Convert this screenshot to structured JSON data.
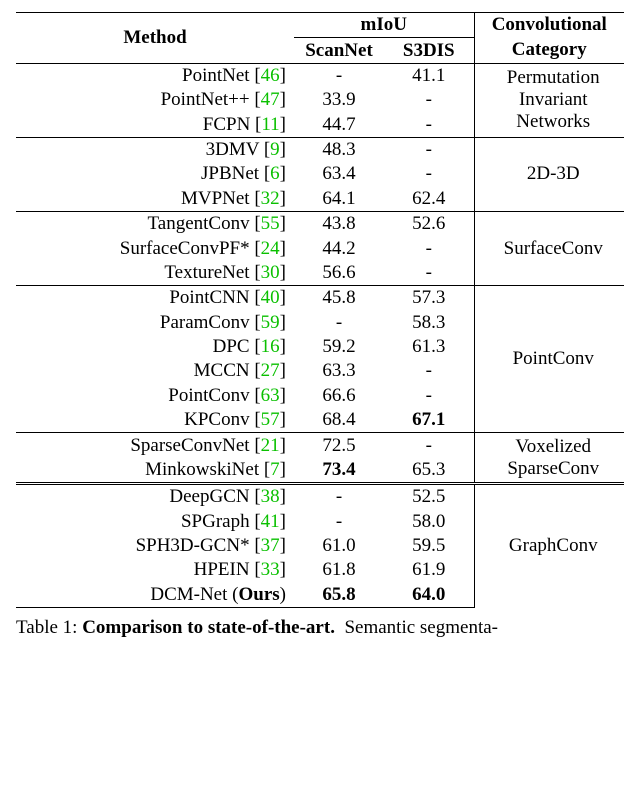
{
  "headers": {
    "method": "Method",
    "miou": "mIoU",
    "scannet": "ScanNet",
    "s3dis": "S3DIS",
    "category_top": "Convolutional",
    "category_bottom": "Category"
  },
  "groups": [
    {
      "category": "Permutation Invariant Networks",
      "rows": [
        {
          "name": "PointNet",
          "ref": "46",
          "scannet": "-",
          "s3dis": "41.1"
        },
        {
          "name": "PointNet++",
          "ref": "47",
          "scannet": "33.9",
          "s3dis": "-"
        },
        {
          "name": "FCPN",
          "ref": "11",
          "scannet": "44.7",
          "s3dis": "-"
        }
      ]
    },
    {
      "category": "2D-3D",
      "rows": [
        {
          "name": "3DMV",
          "ref": "9",
          "scannet": "48.3",
          "s3dis": "-"
        },
        {
          "name": "JPBNet",
          "ref": "6",
          "scannet": "63.4",
          "s3dis": "-"
        },
        {
          "name": "MVPNet",
          "ref": "32",
          "scannet": "64.1",
          "s3dis": "62.4"
        }
      ]
    },
    {
      "category": "SurfaceConv",
      "rows": [
        {
          "name": "TangentConv",
          "ref": "55",
          "scannet": "43.8",
          "s3dis": "52.6"
        },
        {
          "name": "SurfaceConvPF*",
          "ref": "24",
          "scannet": "44.2",
          "s3dis": "-"
        },
        {
          "name": "TextureNet",
          "ref": "30",
          "scannet": "56.6",
          "s3dis": "-"
        }
      ]
    },
    {
      "category": "PointConv",
      "rows": [
        {
          "name": "PointCNN",
          "ref": "40",
          "scannet": "45.8",
          "s3dis": "57.3"
        },
        {
          "name": "ParamConv",
          "ref": "59",
          "scannet": "-",
          "s3dis": "58.3"
        },
        {
          "name": "DPC",
          "ref": "16",
          "scannet": "59.2",
          "s3dis": "61.3"
        },
        {
          "name": "MCCN",
          "ref": "27",
          "scannet": "63.3",
          "s3dis": "-"
        },
        {
          "name": "PointConv",
          "ref": "63",
          "scannet": "66.6",
          "s3dis": "-"
        },
        {
          "name": "KPConv",
          "ref": "57",
          "scannet": "68.4",
          "s3dis": "67.1",
          "s3dis_bold": true
        }
      ]
    },
    {
      "category": "Voxelized SparseConv",
      "rows": [
        {
          "name": "SparseConvNet",
          "ref": "21",
          "scannet": "72.5",
          "s3dis": "-"
        },
        {
          "name": "MinkowskiNet",
          "ref": "7",
          "scannet": "73.4",
          "scannet_bold": true,
          "s3dis": "65.3"
        }
      ]
    },
    {
      "category": "GraphConv",
      "double_rule": true,
      "rows": [
        {
          "name": "DeepGCN",
          "ref": "38",
          "scannet": "-",
          "s3dis": "52.5"
        },
        {
          "name": "SPGraph",
          "ref": "41",
          "scannet": "-",
          "s3dis": "58.0"
        },
        {
          "name": "SPH3D-GCN*",
          "ref": "37",
          "scannet": "61.0",
          "s3dis": "59.5"
        },
        {
          "name": "HPEIN",
          "ref": "33",
          "scannet": "61.8",
          "s3dis": "61.9"
        },
        {
          "name": "DCM-Net (Ours)",
          "name_html": "DCM-Net (<b>Ours</b>)",
          "scannet": "65.8",
          "scannet_bold": true,
          "s3dis": "64.0",
          "s3dis_bold": true
        }
      ]
    }
  ],
  "caption": {
    "label": "Table 1:",
    "title": "Comparison to state-of-the-art.",
    "rest": "Semantic segmenta-"
  },
  "chart_data": {
    "type": "table",
    "title": "Comparison to state-of-the-art",
    "columns": [
      "Method",
      "ScanNet_mIoU",
      "S3DIS_mIoU",
      "ConvolutionalCategory"
    ],
    "rows": [
      [
        "PointNet",
        null,
        41.1,
        "Permutation Invariant Networks"
      ],
      [
        "PointNet++",
        33.9,
        null,
        "Permutation Invariant Networks"
      ],
      [
        "FCPN",
        44.7,
        null,
        "Permutation Invariant Networks"
      ],
      [
        "3DMV",
        48.3,
        null,
        "2D-3D"
      ],
      [
        "JPBNet",
        63.4,
        null,
        "2D-3D"
      ],
      [
        "MVPNet",
        64.1,
        62.4,
        "2D-3D"
      ],
      [
        "TangentConv",
        43.8,
        52.6,
        "SurfaceConv"
      ],
      [
        "SurfaceConvPF*",
        44.2,
        null,
        "SurfaceConv"
      ],
      [
        "TextureNet",
        56.6,
        null,
        "SurfaceConv"
      ],
      [
        "PointCNN",
        45.8,
        57.3,
        "PointConv"
      ],
      [
        "ParamConv",
        null,
        58.3,
        "PointConv"
      ],
      [
        "DPC",
        59.2,
        61.3,
        "PointConv"
      ],
      [
        "MCCN",
        63.3,
        null,
        "PointConv"
      ],
      [
        "PointConv",
        66.6,
        null,
        "PointConv"
      ],
      [
        "KPConv",
        68.4,
        67.1,
        "PointConv"
      ],
      [
        "SparseConvNet",
        72.5,
        null,
        "Voxelized SparseConv"
      ],
      [
        "MinkowskiNet",
        73.4,
        65.3,
        "Voxelized SparseConv"
      ],
      [
        "DeepGCN",
        null,
        52.5,
        "GraphConv"
      ],
      [
        "SPGraph",
        null,
        58.0,
        "GraphConv"
      ],
      [
        "SPH3D-GCN*",
        61.0,
        59.5,
        "GraphConv"
      ],
      [
        "HPEIN",
        61.8,
        61.9,
        "GraphConv"
      ],
      [
        "DCM-Net (Ours)",
        65.8,
        64.0,
        "GraphConv"
      ]
    ]
  }
}
